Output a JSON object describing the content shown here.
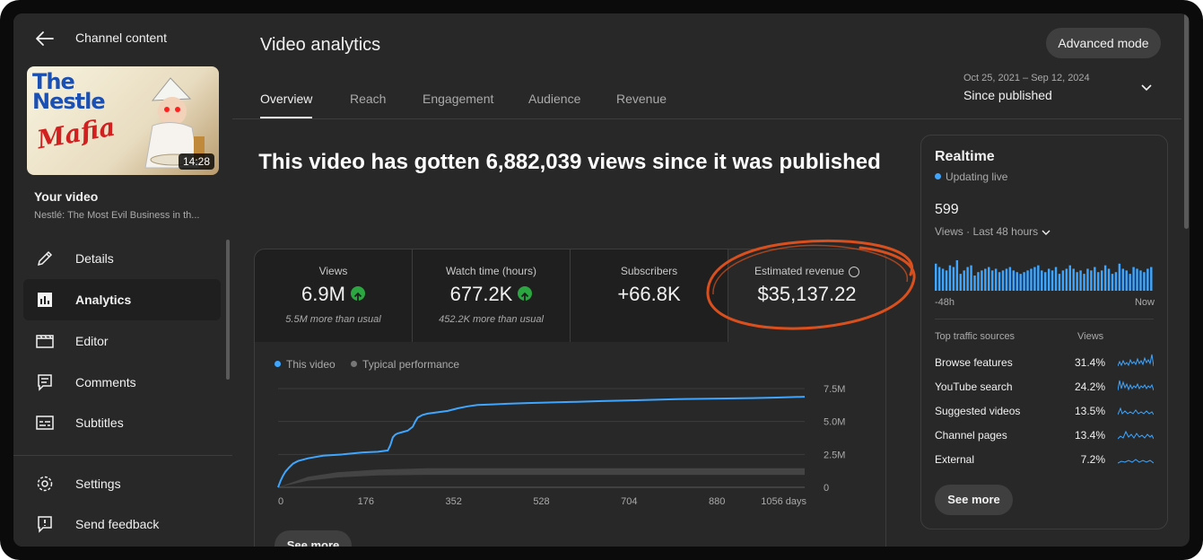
{
  "sidebar": {
    "title": "Channel content",
    "thumbnail": {
      "line1": "The",
      "line2": "Nestle",
      "line3": "Mafia",
      "duration": "14:28"
    },
    "your_video_label": "Your video",
    "video_title": "Nestlé: The Most Evil Business in th...",
    "items": [
      {
        "label": "Details",
        "icon": "pencil-icon"
      },
      {
        "label": "Analytics",
        "icon": "analytics-icon",
        "active": true
      },
      {
        "label": "Editor",
        "icon": "clapperboard-icon"
      },
      {
        "label": "Comments",
        "icon": "comment-icon"
      },
      {
        "label": "Subtitles",
        "icon": "subtitles-icon"
      }
    ],
    "bottom_items": [
      {
        "label": "Settings",
        "icon": "gear-icon"
      },
      {
        "label": "Send feedback",
        "icon": "feedback-icon"
      }
    ]
  },
  "header": {
    "title": "Video analytics",
    "advanced_mode": "Advanced mode",
    "tabs": [
      "Overview",
      "Reach",
      "Engagement",
      "Audience",
      "Revenue"
    ],
    "date_range": "Oct 25, 2021 – Sep 12, 2024",
    "date_label": "Since published"
  },
  "headline": "This video has gotten 6,882,039 views since it was published",
  "metrics": [
    {
      "label": "Views",
      "value": "6.9M",
      "note": "5.5M more than usual",
      "trend": "up"
    },
    {
      "label": "Watch time (hours)",
      "value": "677.2K",
      "note": "452.2K more than usual",
      "trend": "up"
    },
    {
      "label": "Subscribers",
      "value": "+66.8K",
      "note": ""
    },
    {
      "label": "Estimated revenue",
      "value": "$35,137.22",
      "note": ""
    }
  ],
  "chart_data": {
    "type": "line",
    "legend": [
      "This video",
      "Typical performance"
    ],
    "x_ticks": [
      "0",
      "176",
      "352",
      "528",
      "704",
      "880",
      "1056 days"
    ],
    "y_ticks": [
      "7.5M",
      "5.0M",
      "2.5M",
      "0"
    ],
    "xlim": [
      0,
      1056
    ],
    "ylim": [
      0,
      7500000
    ],
    "series": [
      {
        "name": "This video",
        "color": "#3ea6ff",
        "x": [
          0,
          5,
          10,
          15,
          22,
          30,
          40,
          60,
          90,
          130,
          170,
          200,
          220,
          225,
          230,
          235,
          240,
          250,
          260,
          270,
          275,
          280,
          285,
          290,
          300,
          320,
          340,
          360,
          380,
          400,
          430,
          460,
          500,
          550,
          600,
          650,
          700,
          750,
          800,
          850,
          900,
          950,
          1000,
          1056
        ],
        "y": [
          0,
          500000,
          900000,
          1200000,
          1500000,
          1800000,
          2000000,
          2200000,
          2400000,
          2500000,
          2650000,
          2700000,
          2800000,
          3200000,
          3800000,
          4000000,
          4100000,
          4200000,
          4300000,
          4600000,
          5000000,
          5300000,
          5400000,
          5500000,
          5600000,
          5700000,
          5800000,
          6000000,
          6150000,
          6250000,
          6300000,
          6350000,
          6400000,
          6450000,
          6500000,
          6550000,
          6600000,
          6650000,
          6700000,
          6720000,
          6750000,
          6780000,
          6820000,
          6880000
        ]
      }
    ],
    "typical_band": {
      "name": "Typical performance",
      "color": "#3d3d3d",
      "x": [
        0,
        60,
        120,
        200,
        300,
        400,
        500,
        600,
        700,
        800,
        900,
        1000,
        1056
      ],
      "low": [
        0,
        500000,
        750000,
        900000,
        950000,
        950000,
        950000,
        950000,
        950000,
        950000,
        950000,
        950000,
        950000
      ],
      "high": [
        0,
        800000,
        1150000,
        1350000,
        1450000,
        1450000,
        1450000,
        1450000,
        1450000,
        1450000,
        1450000,
        1450000,
        1450000
      ]
    }
  },
  "see_more": "See more",
  "realtime": {
    "title": "Realtime",
    "status": "Updating live",
    "value": "599",
    "subtitle": "Views · Last 48 hours",
    "axis_left": "-48h",
    "axis_right": "Now",
    "bars": [
      16,
      14,
      13,
      12,
      15,
      14,
      18,
      10,
      12,
      14,
      15,
      9,
      11,
      12,
      13,
      14,
      12,
      13,
      11,
      12,
      13,
      14,
      12,
      11,
      10,
      11,
      12,
      13,
      14,
      15,
      12,
      11,
      13,
      12,
      14,
      10,
      12,
      13,
      15,
      13,
      11,
      12,
      10,
      13,
      12,
      14,
      11,
      12,
      15,
      13,
      10,
      11,
      16,
      13,
      12,
      10,
      14,
      13,
      12,
      11,
      13,
      14
    ],
    "traffic_header": "Top traffic sources",
    "traffic_header_right": "Views",
    "sources": [
      {
        "name": "Browse features",
        "pct": "31.4%"
      },
      {
        "name": "YouTube search",
        "pct": "24.2%"
      },
      {
        "name": "Suggested videos",
        "pct": "13.5%"
      },
      {
        "name": "Channel pages",
        "pct": "13.4%"
      },
      {
        "name": "External",
        "pct": "7.2%"
      }
    ],
    "see_more": "See more"
  },
  "colors": {
    "accent": "#3ea6ff",
    "up": "#2ba640",
    "annotation": "#d9501e"
  }
}
